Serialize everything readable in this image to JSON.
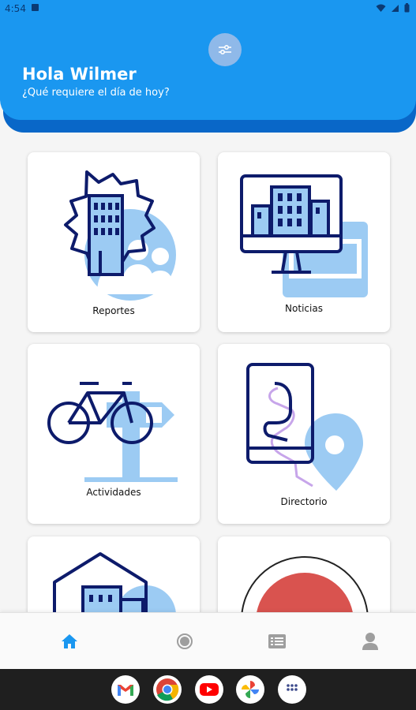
{
  "status_bar": {
    "time": "4:54"
  },
  "header": {
    "greeting": "Hola Wilmer",
    "subtitle": "¿Qué requiere el día de hoy?",
    "settings_icon": "sliders-icon"
  },
  "cards": [
    {
      "label": "Reportes",
      "icon": "building-gear-people-icon"
    },
    {
      "label": "Noticias",
      "icon": "monitor-building-icon"
    },
    {
      "label": "Actividades",
      "icon": "bicycle-signpost-icon"
    },
    {
      "label": "Directorio",
      "icon": "phone-route-map-pin-icon"
    }
  ],
  "bottom_nav": [
    {
      "icon": "home-icon",
      "active": true
    },
    {
      "icon": "radio-target-icon",
      "active": false
    },
    {
      "icon": "list-icon",
      "active": false
    },
    {
      "icon": "user-icon",
      "active": false
    }
  ],
  "taskbar_apps": [
    "gmail-icon",
    "chrome-icon",
    "youtube-icon",
    "photos-icon",
    "app-drawer-icon"
  ],
  "colors": {
    "header": "#1a97f0",
    "header_shadow": "#0967c8",
    "navy": "#0d1b6b",
    "light_blue": "#9ccbf3",
    "lavender": "#c7a5ea",
    "active_nav": "#1a97f0"
  }
}
